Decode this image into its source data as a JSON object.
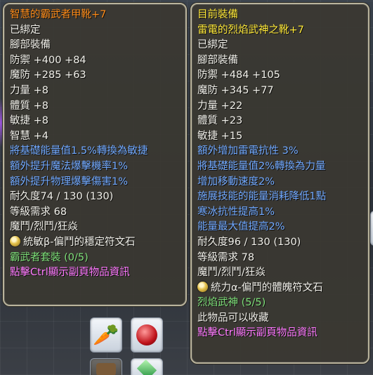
{
  "left_tooltip": {
    "lines": [
      {
        "text": "智慧的霸武者甲靴+7",
        "color": "orange"
      },
      {
        "text": "已綁定",
        "color": "white"
      },
      {
        "text": "腳部裝備",
        "color": "white"
      },
      {
        "text": "防禦 +400 +84",
        "color": "white"
      },
      {
        "text": "魔防 +285 +63",
        "color": "white"
      },
      {
        "text": "力量 +8",
        "color": "white"
      },
      {
        "text": "體質 +8",
        "color": "white"
      },
      {
        "text": "敏捷 +8",
        "color": "white"
      },
      {
        "text": "智慧 +4",
        "color": "white"
      },
      {
        "text": "將基礎能量值1.5%轉換為敏捷",
        "color": "blue"
      },
      {
        "text": "額外提升魔法爆擊機率1%",
        "color": "blue"
      },
      {
        "text": "額外提升物理爆擊傷害1%",
        "color": "blue"
      },
      {
        "text": "耐久度74 / 130 (130)",
        "color": "white"
      },
      {
        "text": "等級需求 68",
        "color": "white"
      },
      {
        "text": "魔鬥/烈鬥/狂焱",
        "color": "white"
      },
      {
        "text": "統敏β-偏鬥的穩定符文石",
        "color": "white",
        "gem": true
      },
      {
        "text": "霸武者套裝 (0/5)",
        "color": "green"
      },
      {
        "text": "點擊Ctrl顯示副頁物品資訊",
        "color": "pink"
      }
    ]
  },
  "right_tooltip": {
    "lines": [
      {
        "text": "目前裝備",
        "color": "yellow"
      },
      {
        "text": "雷電的烈焰武神之靴+7",
        "color": "yellow"
      },
      {
        "text": "已綁定",
        "color": "white"
      },
      {
        "text": "腳部裝備",
        "color": "white"
      },
      {
        "text": "防禦 +484 +105",
        "color": "white"
      },
      {
        "text": "魔防 +345 +77",
        "color": "white"
      },
      {
        "text": "力量 +22",
        "color": "white"
      },
      {
        "text": "體質 +23",
        "color": "white"
      },
      {
        "text": "敏捷 +15",
        "color": "white"
      },
      {
        "text": "額外增加雷電抗性 3%",
        "color": "blue"
      },
      {
        "text": "將基礎能量值2%轉換為力量",
        "color": "blue"
      },
      {
        "text": "增加移動速度2%",
        "color": "blue"
      },
      {
        "text": "施展技能的能量消耗降低1點",
        "color": "blue"
      },
      {
        "text": "寒冰抗性提高1%",
        "color": "blue"
      },
      {
        "text": "能量最大值提高2%",
        "color": "blue"
      },
      {
        "text": "耐久度96 / 130 (130)",
        "color": "white"
      },
      {
        "text": "等級需求 78",
        "color": "white"
      },
      {
        "text": "魔鬥/烈鬥/狂焱",
        "color": "white"
      },
      {
        "text": "統力α-偏鬥的體魄符文石",
        "color": "white",
        "gem": true
      },
      {
        "text": "烈焰武神 (5/5)",
        "color": "green"
      },
      {
        "text": "此物品可以收藏",
        "color": "white"
      },
      {
        "text": "點擊Ctrl顯示副頁物品資訊",
        "color": "pink"
      }
    ]
  },
  "inventory_icons": [
    "carrot-icon",
    "red-orb-icon",
    "shield-icon",
    "bag-icon",
    "green-gem-icon"
  ]
}
